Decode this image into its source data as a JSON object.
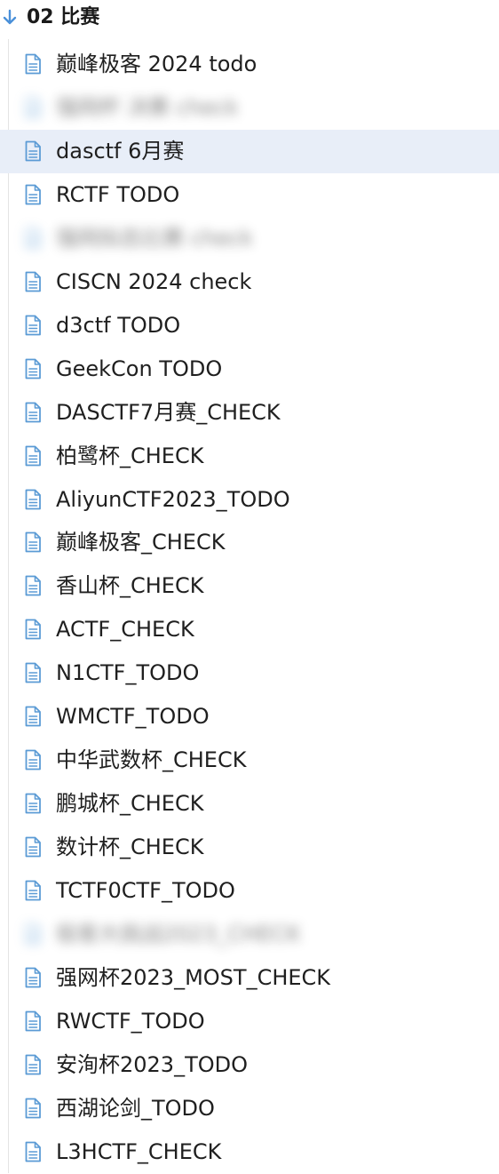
{
  "folder": {
    "title": "02 比赛",
    "icon": "arrow-down-icon",
    "accent_color": "#4a90d9"
  },
  "colors": {
    "doc_icon": "#5b9bd5",
    "selected_row_bg": "#e8eef8"
  },
  "items": [
    {
      "label": "巅峰极客 2024 todo",
      "icon": "document-icon"
    },
    {
      "label": "强网杯 决赛 check",
      "icon": "document-icon",
      "blurred": true
    },
    {
      "label": "dasctf 6月赛",
      "icon": "document-icon",
      "selected": true
    },
    {
      "label": "RCTF TODO",
      "icon": "document-icon"
    },
    {
      "label": "强网拟态比赛 check",
      "icon": "document-icon",
      "blurred": true
    },
    {
      "label": "CISCN 2024 check",
      "icon": "document-icon"
    },
    {
      "label": "d3ctf TODO",
      "icon": "document-icon"
    },
    {
      "label": "GeekCon TODO",
      "icon": "document-icon"
    },
    {
      "label": "DASCTF7月赛_CHECK",
      "icon": "document-icon"
    },
    {
      "label": "柏鹭杯_CHECK",
      "icon": "document-icon"
    },
    {
      "label": "AliyunCTF2023_TODO",
      "icon": "document-icon"
    },
    {
      "label": "巅峰极客_CHECK",
      "icon": "document-icon"
    },
    {
      "label": "香山杯_CHECK",
      "icon": "document-icon"
    },
    {
      "label": "ACTF_CHECK",
      "icon": "document-icon"
    },
    {
      "label": "N1CTF_TODO",
      "icon": "document-icon"
    },
    {
      "label": "WMCTF_TODO",
      "icon": "document-icon"
    },
    {
      "label": "中华武数杯_CHECK",
      "icon": "document-icon"
    },
    {
      "label": "鹏城杯_CHECK",
      "icon": "document-icon"
    },
    {
      "label": "数计杯_CHECK",
      "icon": "document-icon"
    },
    {
      "label": "TCTF0CTF_TODO",
      "icon": "document-icon"
    },
    {
      "label": "极客大挑战2023_CHECK",
      "icon": "document-icon",
      "blurred": true
    },
    {
      "label": "强网杯2023_MOST_CHECK",
      "icon": "document-icon"
    },
    {
      "label": "RWCTF_TODO",
      "icon": "document-icon"
    },
    {
      "label": "安洵杯2023_TODO",
      "icon": "document-icon"
    },
    {
      "label": "西湖论剑_TODO",
      "icon": "document-icon"
    },
    {
      "label": "L3HCTF_CHECK",
      "icon": "document-icon"
    }
  ]
}
